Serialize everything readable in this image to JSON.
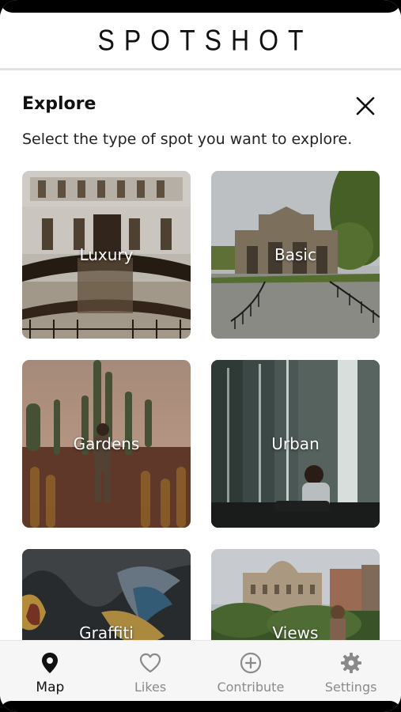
{
  "app": {
    "logo": "SPOTSHOT"
  },
  "explore": {
    "title": "Explore",
    "subtitle": "Select the type of spot you want to explore."
  },
  "categories": [
    {
      "label": "Luxury"
    },
    {
      "label": "Basic"
    },
    {
      "label": "Gardens"
    },
    {
      "label": "Urban"
    },
    {
      "label": "Graffiti"
    },
    {
      "label": "Views"
    }
  ],
  "tabs": [
    {
      "label": "Map",
      "icon": "map-pin-icon",
      "active": true
    },
    {
      "label": "Likes",
      "icon": "heart-icon",
      "active": false
    },
    {
      "label": "Contribute",
      "icon": "plus-circle-icon",
      "active": false
    },
    {
      "label": "Settings",
      "icon": "gear-icon",
      "active": false
    }
  ],
  "colors": {
    "active_tab": "#111111",
    "inactive_tab": "#8a8a8a",
    "tabbar_bg": "#f6f6f6"
  }
}
